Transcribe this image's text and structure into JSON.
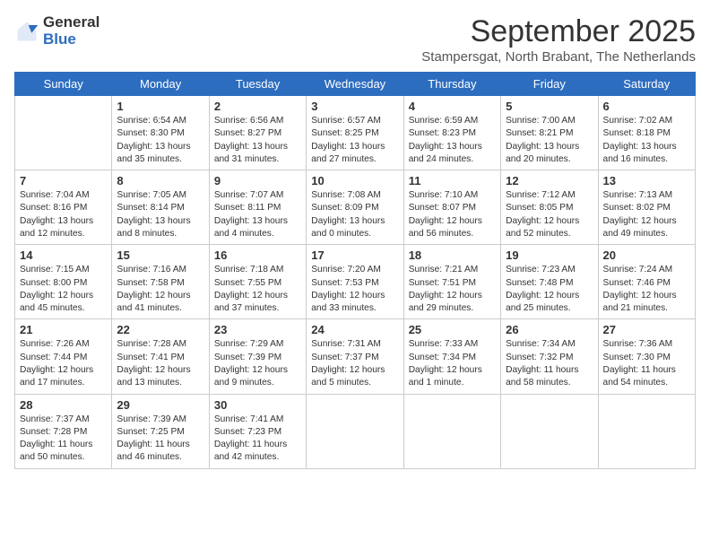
{
  "header": {
    "logo_general": "General",
    "logo_blue": "Blue",
    "month_title": "September 2025",
    "subtitle": "Stampersgat, North Brabant, The Netherlands"
  },
  "days_of_week": [
    "Sunday",
    "Monday",
    "Tuesday",
    "Wednesday",
    "Thursday",
    "Friday",
    "Saturday"
  ],
  "weeks": [
    [
      {
        "day": "",
        "text": ""
      },
      {
        "day": "1",
        "text": "Sunrise: 6:54 AM\nSunset: 8:30 PM\nDaylight: 13 hours and 35 minutes."
      },
      {
        "day": "2",
        "text": "Sunrise: 6:56 AM\nSunset: 8:27 PM\nDaylight: 13 hours and 31 minutes."
      },
      {
        "day": "3",
        "text": "Sunrise: 6:57 AM\nSunset: 8:25 PM\nDaylight: 13 hours and 27 minutes."
      },
      {
        "day": "4",
        "text": "Sunrise: 6:59 AM\nSunset: 8:23 PM\nDaylight: 13 hours and 24 minutes."
      },
      {
        "day": "5",
        "text": "Sunrise: 7:00 AM\nSunset: 8:21 PM\nDaylight: 13 hours and 20 minutes."
      },
      {
        "day": "6",
        "text": "Sunrise: 7:02 AM\nSunset: 8:18 PM\nDaylight: 13 hours and 16 minutes."
      }
    ],
    [
      {
        "day": "7",
        "text": "Sunrise: 7:04 AM\nSunset: 8:16 PM\nDaylight: 13 hours and 12 minutes."
      },
      {
        "day": "8",
        "text": "Sunrise: 7:05 AM\nSunset: 8:14 PM\nDaylight: 13 hours and 8 minutes."
      },
      {
        "day": "9",
        "text": "Sunrise: 7:07 AM\nSunset: 8:11 PM\nDaylight: 13 hours and 4 minutes."
      },
      {
        "day": "10",
        "text": "Sunrise: 7:08 AM\nSunset: 8:09 PM\nDaylight: 13 hours and 0 minutes."
      },
      {
        "day": "11",
        "text": "Sunrise: 7:10 AM\nSunset: 8:07 PM\nDaylight: 12 hours and 56 minutes."
      },
      {
        "day": "12",
        "text": "Sunrise: 7:12 AM\nSunset: 8:05 PM\nDaylight: 12 hours and 52 minutes."
      },
      {
        "day": "13",
        "text": "Sunrise: 7:13 AM\nSunset: 8:02 PM\nDaylight: 12 hours and 49 minutes."
      }
    ],
    [
      {
        "day": "14",
        "text": "Sunrise: 7:15 AM\nSunset: 8:00 PM\nDaylight: 12 hours and 45 minutes."
      },
      {
        "day": "15",
        "text": "Sunrise: 7:16 AM\nSunset: 7:58 PM\nDaylight: 12 hours and 41 minutes."
      },
      {
        "day": "16",
        "text": "Sunrise: 7:18 AM\nSunset: 7:55 PM\nDaylight: 12 hours and 37 minutes."
      },
      {
        "day": "17",
        "text": "Sunrise: 7:20 AM\nSunset: 7:53 PM\nDaylight: 12 hours and 33 minutes."
      },
      {
        "day": "18",
        "text": "Sunrise: 7:21 AM\nSunset: 7:51 PM\nDaylight: 12 hours and 29 minutes."
      },
      {
        "day": "19",
        "text": "Sunrise: 7:23 AM\nSunset: 7:48 PM\nDaylight: 12 hours and 25 minutes."
      },
      {
        "day": "20",
        "text": "Sunrise: 7:24 AM\nSunset: 7:46 PM\nDaylight: 12 hours and 21 minutes."
      }
    ],
    [
      {
        "day": "21",
        "text": "Sunrise: 7:26 AM\nSunset: 7:44 PM\nDaylight: 12 hours and 17 minutes."
      },
      {
        "day": "22",
        "text": "Sunrise: 7:28 AM\nSunset: 7:41 PM\nDaylight: 12 hours and 13 minutes."
      },
      {
        "day": "23",
        "text": "Sunrise: 7:29 AM\nSunset: 7:39 PM\nDaylight: 12 hours and 9 minutes."
      },
      {
        "day": "24",
        "text": "Sunrise: 7:31 AM\nSunset: 7:37 PM\nDaylight: 12 hours and 5 minutes."
      },
      {
        "day": "25",
        "text": "Sunrise: 7:33 AM\nSunset: 7:34 PM\nDaylight: 12 hours and 1 minute."
      },
      {
        "day": "26",
        "text": "Sunrise: 7:34 AM\nSunset: 7:32 PM\nDaylight: 11 hours and 58 minutes."
      },
      {
        "day": "27",
        "text": "Sunrise: 7:36 AM\nSunset: 7:30 PM\nDaylight: 11 hours and 54 minutes."
      }
    ],
    [
      {
        "day": "28",
        "text": "Sunrise: 7:37 AM\nSunset: 7:28 PM\nDaylight: 11 hours and 50 minutes."
      },
      {
        "day": "29",
        "text": "Sunrise: 7:39 AM\nSunset: 7:25 PM\nDaylight: 11 hours and 46 minutes."
      },
      {
        "day": "30",
        "text": "Sunrise: 7:41 AM\nSunset: 7:23 PM\nDaylight: 11 hours and 42 minutes."
      },
      {
        "day": "",
        "text": ""
      },
      {
        "day": "",
        "text": ""
      },
      {
        "day": "",
        "text": ""
      },
      {
        "day": "",
        "text": ""
      }
    ]
  ]
}
